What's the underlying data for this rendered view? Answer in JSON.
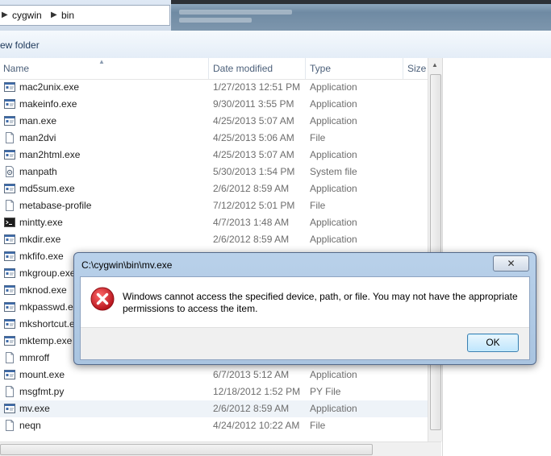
{
  "address": {
    "crumbs": [
      "cygwin",
      "bin"
    ]
  },
  "toolbar": {
    "new_folder": "ew folder"
  },
  "columns": {
    "name": "Name",
    "date": "Date modified",
    "type": "Type",
    "size": "Size"
  },
  "files": [
    {
      "name": "mac2unix.exe",
      "date": "1/27/2013 12:51 PM",
      "type": "Application",
      "icon": "exe-icon"
    },
    {
      "name": "makeinfo.exe",
      "date": "9/30/2011 3:55 PM",
      "type": "Application",
      "icon": "exe-icon"
    },
    {
      "name": "man.exe",
      "date": "4/25/2013 5:07 AM",
      "type": "Application",
      "icon": "exe-icon"
    },
    {
      "name": "man2dvi",
      "date": "4/25/2013 5:06 AM",
      "type": "File",
      "icon": "file-icon"
    },
    {
      "name": "man2html.exe",
      "date": "4/25/2013 5:07 AM",
      "type": "Application",
      "icon": "exe-icon"
    },
    {
      "name": "manpath",
      "date": "5/30/2013 1:54 PM",
      "type": "System file",
      "icon": "system-file-icon"
    },
    {
      "name": "md5sum.exe",
      "date": "2/6/2012 8:59 AM",
      "type": "Application",
      "icon": "exe-icon"
    },
    {
      "name": "metabase-profile",
      "date": "7/12/2012 5:01 PM",
      "type": "File",
      "icon": "file-icon"
    },
    {
      "name": "mintty.exe",
      "date": "4/7/2013 1:48 AM",
      "type": "Application",
      "icon": "terminal-icon"
    },
    {
      "name": "mkdir.exe",
      "date": "2/6/2012 8:59 AM",
      "type": "Application",
      "icon": "exe-icon"
    },
    {
      "name": "mkfifo.exe",
      "date": "",
      "type": "",
      "icon": "exe-icon"
    },
    {
      "name": "mkgroup.exe",
      "date": "",
      "type": "",
      "icon": "exe-icon"
    },
    {
      "name": "mknod.exe",
      "date": "",
      "type": "",
      "icon": "exe-icon"
    },
    {
      "name": "mkpasswd.exe",
      "date": "",
      "type": "",
      "icon": "exe-icon"
    },
    {
      "name": "mkshortcut.exe",
      "date": "",
      "type": "",
      "icon": "exe-icon"
    },
    {
      "name": "mktemp.exe",
      "date": "",
      "type": "",
      "icon": "exe-icon"
    },
    {
      "name": "mmroff",
      "date": "",
      "type": "",
      "icon": "file-icon"
    },
    {
      "name": "mount.exe",
      "date": "6/7/2013 5:12 AM",
      "type": "Application",
      "icon": "exe-icon"
    },
    {
      "name": "msgfmt.py",
      "date": "12/18/2012 1:52 PM",
      "type": "PY File",
      "icon": "file-icon"
    },
    {
      "name": "mv.exe",
      "date": "2/6/2012 8:59 AM",
      "type": "Application",
      "icon": "exe-icon",
      "selected": true
    },
    {
      "name": "neqn",
      "date": "4/24/2012 10:22 AM",
      "type": "File",
      "icon": "file-icon"
    }
  ],
  "dialog": {
    "title": "C:\\cygwin\\bin\\mv.exe",
    "message": "Windows cannot access the specified device, path, or file.  You may not have the appropriate permissions to access the item.",
    "ok": "OK",
    "close": "✕",
    "error_color": "#d3262c"
  }
}
